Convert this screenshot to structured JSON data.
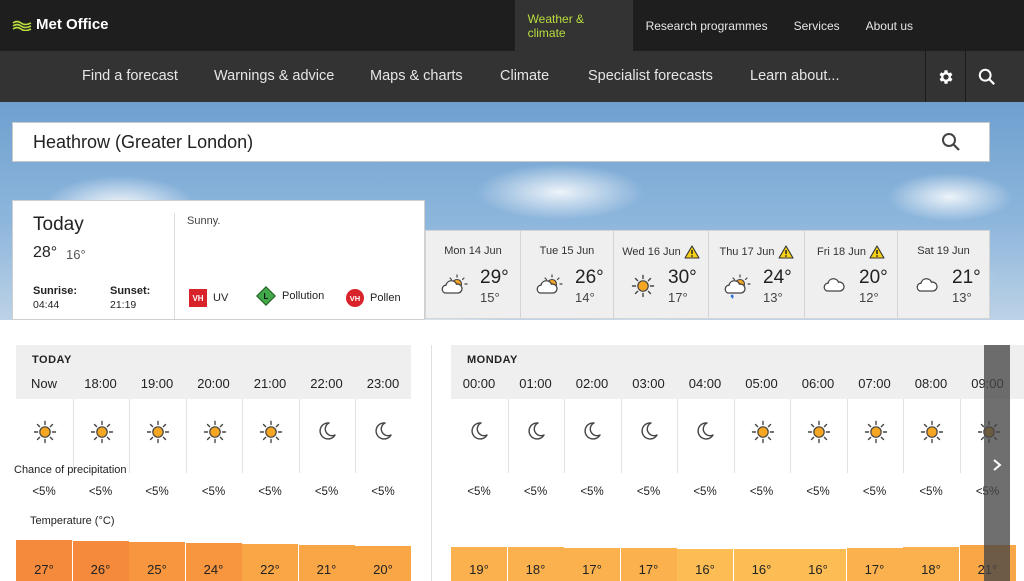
{
  "brand": {
    "name": "Met Office"
  },
  "topnav": [
    {
      "label": "Weather & climate",
      "active": true
    },
    {
      "label": "Research programmes",
      "active": false
    },
    {
      "label": "Services",
      "active": false
    },
    {
      "label": "About us",
      "active": false
    }
  ],
  "mainnav": [
    {
      "label": "Find a forecast"
    },
    {
      "label": "Warnings & advice"
    },
    {
      "label": "Maps & charts"
    },
    {
      "label": "Climate"
    },
    {
      "label": "Specialist forecasts"
    },
    {
      "label": "Learn about..."
    }
  ],
  "search": {
    "value": "Heathrow (Greater London)"
  },
  "today": {
    "title": "Today",
    "high": "28°",
    "low": "16°",
    "summary": "Sunny.",
    "sunrise_label": "Sunrise:",
    "sunrise": "04:44",
    "sunset_label": "Sunset:",
    "sunset": "21:19",
    "uv": {
      "badge": "VH",
      "label": "UV",
      "color": "#d9232a"
    },
    "pollution": {
      "badge": "L",
      "label": "Pollution",
      "color": "#42a84a"
    },
    "pollen": {
      "badge": "VH",
      "label": "Pollen",
      "color": "#d9232a"
    }
  },
  "days": [
    {
      "name": "Mon 14 Jun",
      "hi": "29°",
      "lo": "15°",
      "icon": "sun-cloud-icon",
      "warning": false
    },
    {
      "name": "Tue 15 Jun",
      "hi": "26°",
      "lo": "14°",
      "icon": "sun-cloud-icon",
      "warning": false
    },
    {
      "name": "Wed 16 Jun",
      "hi": "30°",
      "lo": "17°",
      "icon": "sun-icon",
      "warning": true
    },
    {
      "name": "Thu 17 Jun",
      "hi": "24°",
      "lo": "13°",
      "icon": "sun-cloud-rain-icon",
      "warning": true
    },
    {
      "name": "Fri 18 Jun",
      "hi": "20°",
      "lo": "12°",
      "icon": "cloud-icon",
      "warning": true
    },
    {
      "name": "Sat 19 Jun",
      "hi": "21°",
      "lo": "13°",
      "icon": "cloud-icon",
      "warning": false
    }
  ],
  "labels": {
    "precip": "Chance of precipitation",
    "temperature": "Temperature (°C)"
  },
  "hourly_today": {
    "title": "TODAY",
    "hours": [
      {
        "time": "Now",
        "icon": "sun-icon",
        "precip": "<5%",
        "temp": "27°",
        "temp_c": 27
      },
      {
        "time": "18:00",
        "icon": "sun-icon",
        "precip": "<5%",
        "temp": "26°",
        "temp_c": 26
      },
      {
        "time": "19:00",
        "icon": "sun-icon",
        "precip": "<5%",
        "temp": "25°",
        "temp_c": 25
      },
      {
        "time": "20:00",
        "icon": "sun-icon",
        "precip": "<5%",
        "temp": "24°",
        "temp_c": 24
      },
      {
        "time": "21:00",
        "icon": "sun-icon",
        "precip": "<5%",
        "temp": "22°",
        "temp_c": 22
      },
      {
        "time": "22:00",
        "icon": "moon-icon",
        "precip": "<5%",
        "temp": "21°",
        "temp_c": 21
      },
      {
        "time": "23:00",
        "icon": "moon-icon",
        "precip": "<5%",
        "temp": "20°",
        "temp_c": 20
      }
    ]
  },
  "hourly_monday": {
    "title": "MONDAY",
    "hours": [
      {
        "time": "00:00",
        "icon": "moon-icon",
        "precip": "<5%",
        "temp": "19°",
        "temp_c": 19
      },
      {
        "time": "01:00",
        "icon": "moon-icon",
        "precip": "<5%",
        "temp": "18°",
        "temp_c": 18
      },
      {
        "time": "02:00",
        "icon": "moon-icon",
        "precip": "<5%",
        "temp": "17°",
        "temp_c": 17
      },
      {
        "time": "03:00",
        "icon": "moon-icon",
        "precip": "<5%",
        "temp": "17°",
        "temp_c": 17
      },
      {
        "time": "04:00",
        "icon": "moon-icon",
        "precip": "<5%",
        "temp": "16°",
        "temp_c": 16
      },
      {
        "time": "05:00",
        "icon": "sun-icon",
        "precip": "<5%",
        "temp": "16°",
        "temp_c": 16
      },
      {
        "time": "06:00",
        "icon": "sun-icon",
        "precip": "<5%",
        "temp": "16°",
        "temp_c": 16
      },
      {
        "time": "07:00",
        "icon": "sun-icon",
        "precip": "<5%",
        "temp": "17°",
        "temp_c": 17
      },
      {
        "time": "08:00",
        "icon": "sun-icon",
        "precip": "<5%",
        "temp": "18°",
        "temp_c": 18
      },
      {
        "time": "09:00",
        "icon": "sun-icon",
        "precip": "<5%",
        "temp": "21°",
        "temp_c": 21
      }
    ]
  },
  "colors": {
    "accent": "#b9dd3f",
    "topbar": "#1e1e1e",
    "nav": "#333333",
    "sun": "#f5a623",
    "warning": "#f7d117"
  }
}
